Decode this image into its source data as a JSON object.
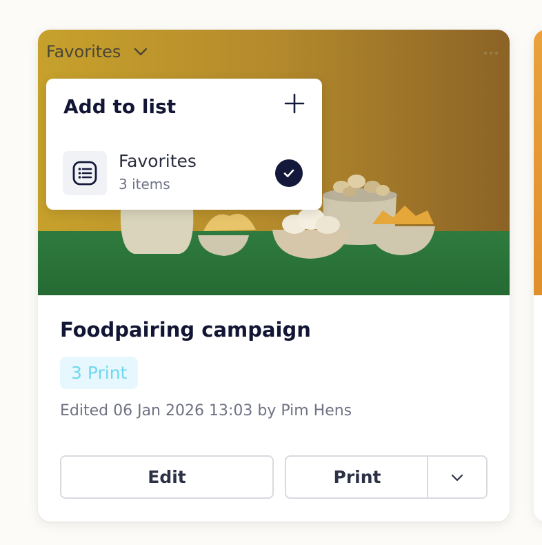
{
  "card": {
    "list_selector": "Favorites",
    "title": "Foodpairing campaign",
    "badge": "3 Print",
    "edited": "Edited 06 Jan 2026 13:03 by Pim Hens",
    "buttons": {
      "edit": "Edit",
      "print": "Print"
    }
  },
  "popover": {
    "title": "Add to list",
    "lists": [
      {
        "name": "Favorites",
        "count": "3 items",
        "checked": true
      }
    ]
  },
  "icons": {
    "chevron": "chevron-down-icon",
    "more": "more-horizontal-icon",
    "add": "plus-icon",
    "list": "list-icon",
    "check": "check-icon"
  },
  "colors": {
    "title": "#121634",
    "badge_bg": "#e6f8fd",
    "badge_text": "#6fd7ef",
    "check_bg": "#14183a"
  }
}
